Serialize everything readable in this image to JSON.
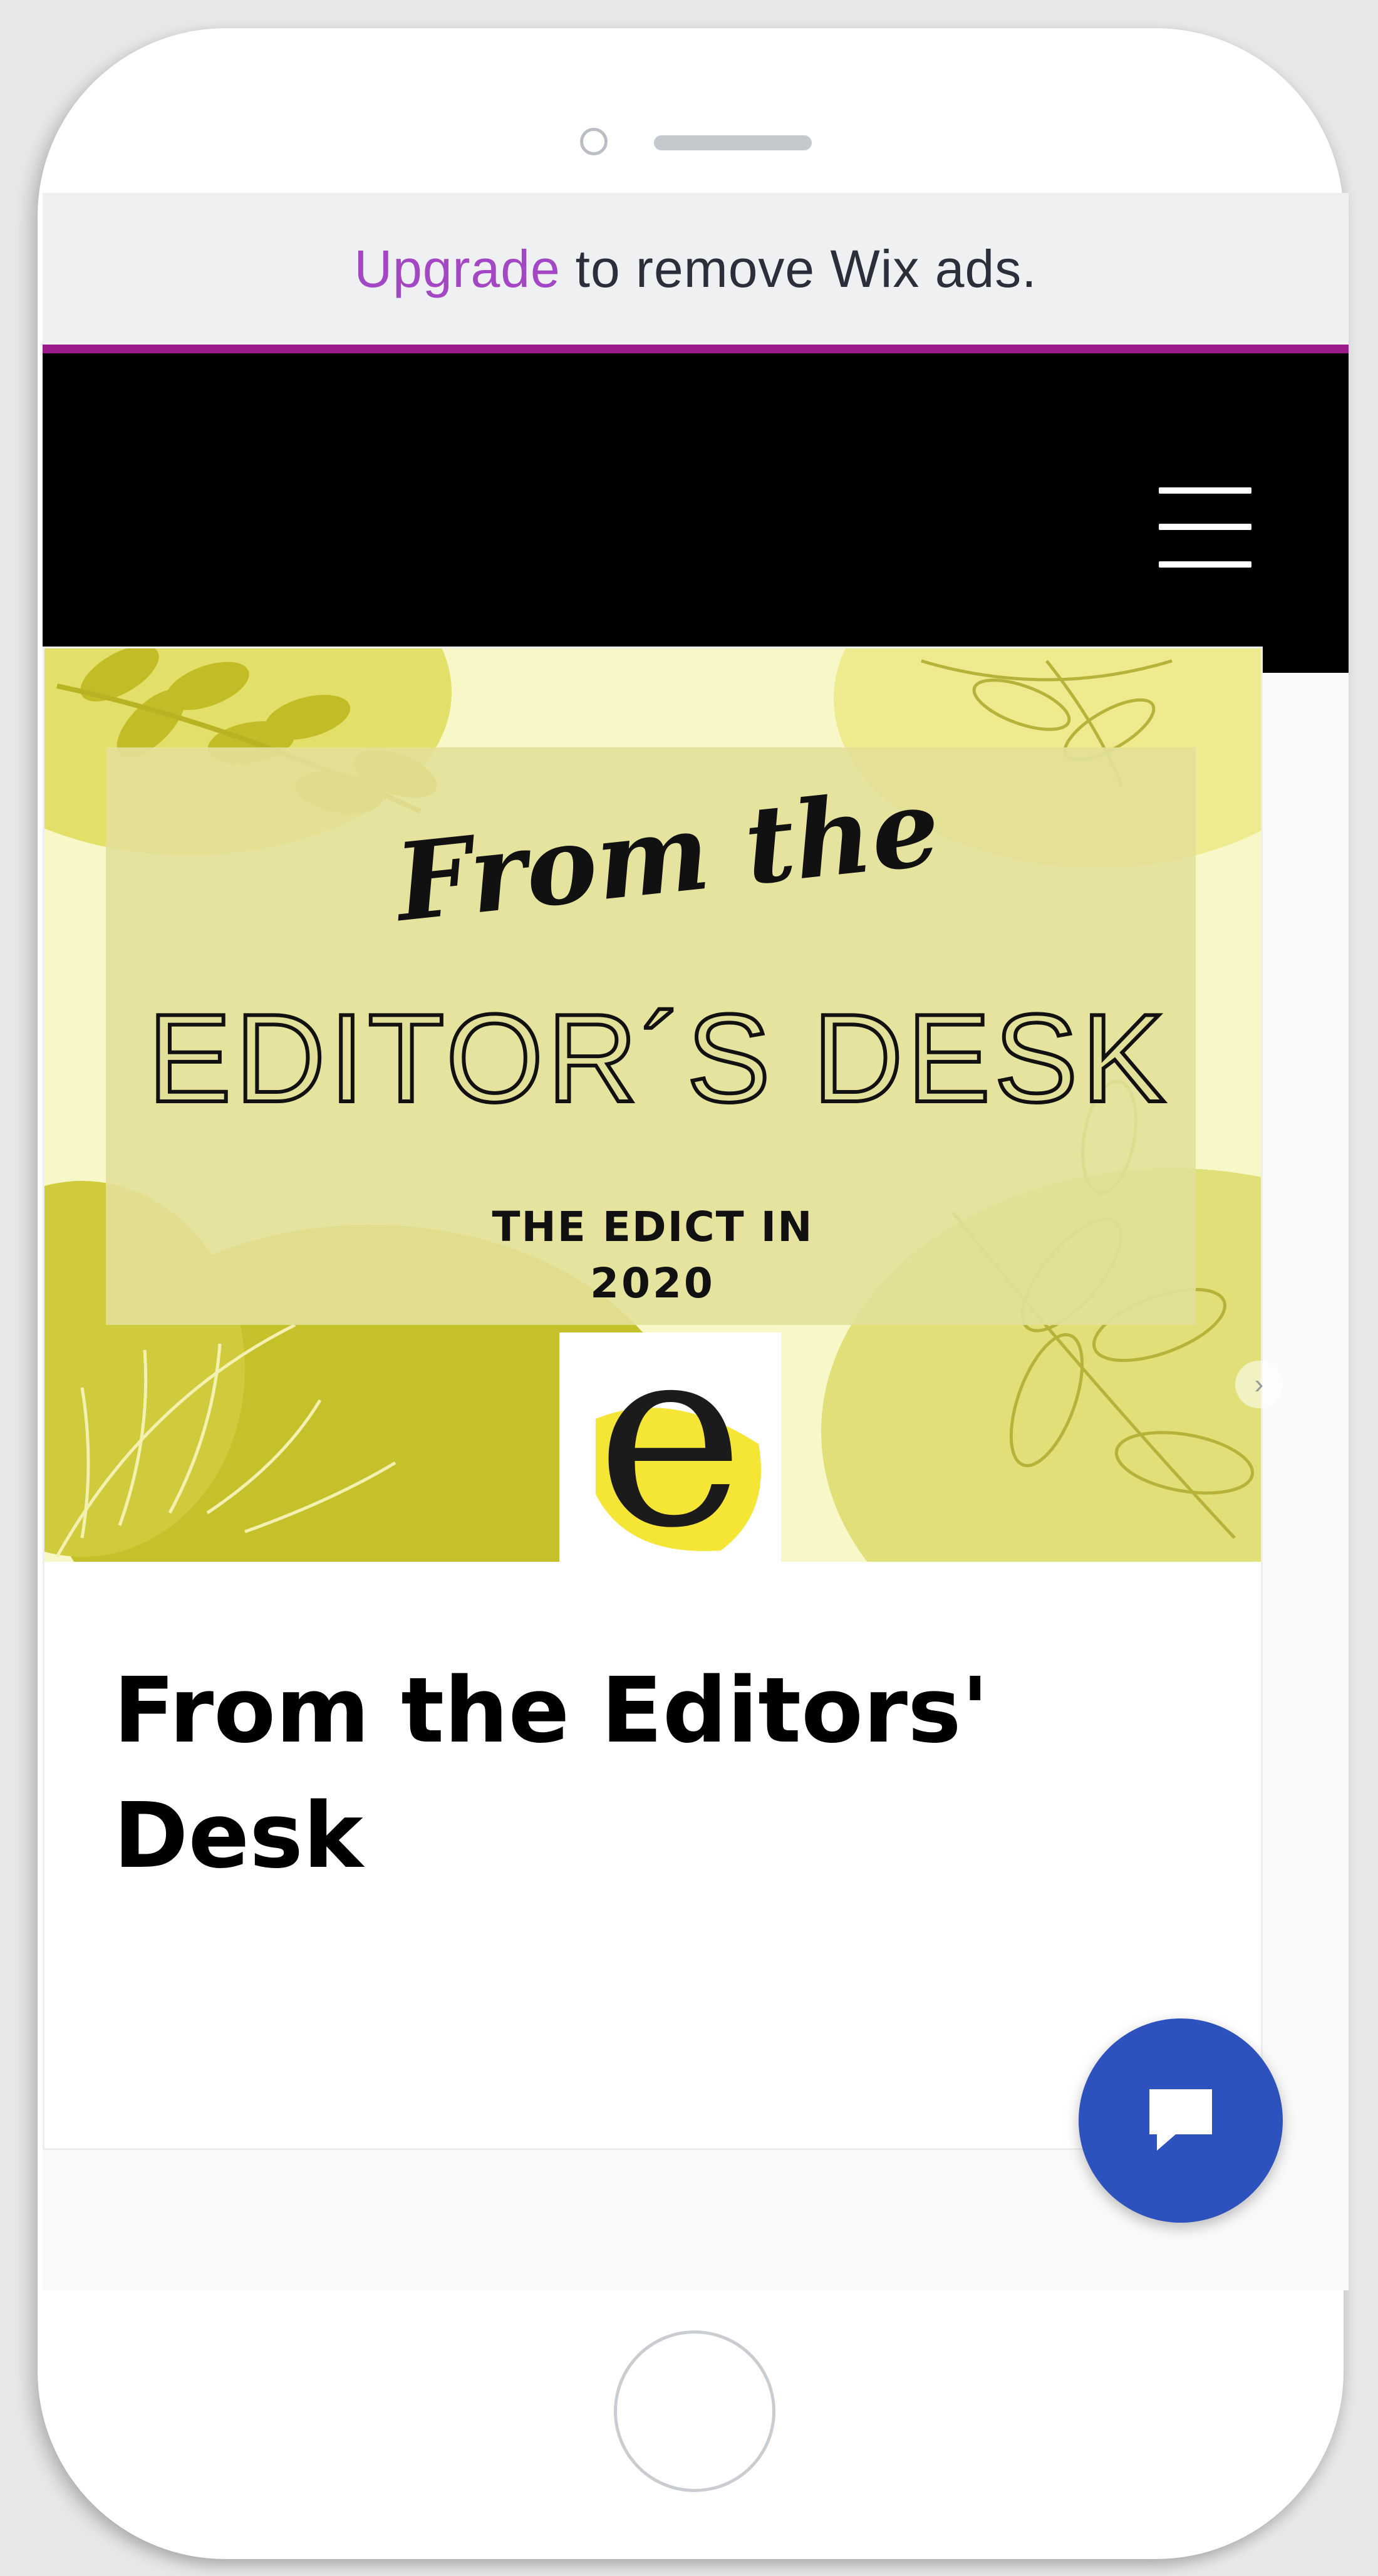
{
  "ad_banner": {
    "upgrade_link": "Upgrade",
    "message": "to remove Wix ads."
  },
  "header": {
    "menu_icon": "hamburger-menu-icon"
  },
  "post": {
    "image": {
      "script_line": "From the",
      "headline": "EDITOR´S DESK",
      "subline_1": "THE EDICT IN",
      "subline_2": "2020",
      "logo_letter": "e"
    },
    "title": "From the Editors' Desk"
  },
  "chat": {
    "icon": "chat-bubble-icon"
  },
  "colors": {
    "upgrade_link": "#a347c4",
    "header_bg": "#000000",
    "accent_line": "#9b1a8c",
    "chat_button": "#2d52be",
    "image_bg": "#f6f6c4"
  }
}
